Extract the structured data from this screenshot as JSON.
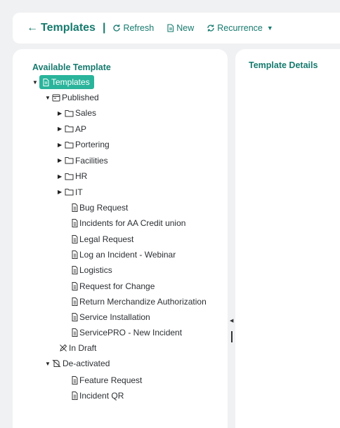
{
  "header": {
    "title": "Templates",
    "separator": "|",
    "refresh_label": "Refresh",
    "new_label": "New",
    "recurrence_label": "Recurrence"
  },
  "left_panel": {
    "title": "Available Template"
  },
  "right_panel": {
    "title": "Template Details"
  },
  "tree": {
    "root": "Templates",
    "published": "Published",
    "folders": [
      "Sales",
      "AP",
      "Portering",
      "Facilities",
      "HR",
      "IT"
    ],
    "published_templates": [
      "Bug Request",
      "Incidents for AA Credit union",
      "Legal Request",
      "Log an Incident - Webinar",
      "Logistics",
      "Request for Change",
      "Return Merchandize Authorization",
      "Service Installation",
      "ServicePRO - New Incident"
    ],
    "in_draft": "In Draft",
    "deactivated": "De-activated",
    "deactivated_templates": [
      "Feature Request",
      "Incident QR"
    ]
  },
  "colors": {
    "accent": "#167a6e",
    "selection": "#2ab49b",
    "background": "#f0f1f3"
  }
}
